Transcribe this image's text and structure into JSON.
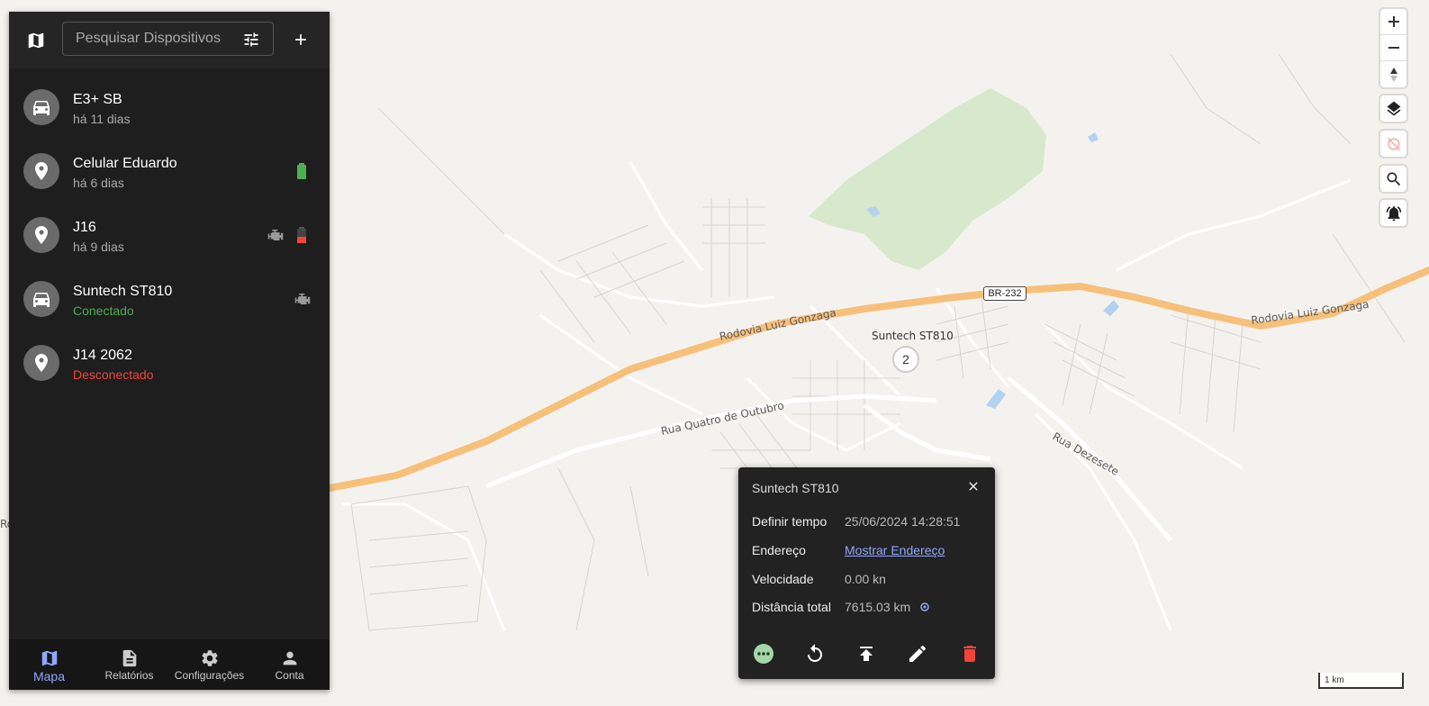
{
  "search": {
    "placeholder": "Pesquisar Dispositivos"
  },
  "devices": [
    {
      "name": "E3+ SB",
      "status": "há 11 dias",
      "icon": "car-icon"
    },
    {
      "name": "Celular Eduardo",
      "status": "há 6 dias",
      "icon": "location-pin-icon"
    },
    {
      "name": "J16",
      "status": "há 9 dias",
      "icon": "location-pin-icon"
    },
    {
      "name": "Suntech ST810",
      "status": "Conectado",
      "icon": "car-icon"
    },
    {
      "name": "J14 2062",
      "status": "Desconectado",
      "icon": "location-pin-icon"
    }
  ],
  "nav": [
    {
      "label": "Mapa",
      "icon": "map-icon"
    },
    {
      "label": "Relatórios",
      "icon": "report-icon"
    },
    {
      "label": "Configurações",
      "icon": "gear-icon"
    },
    {
      "label": "Conta",
      "icon": "person-icon"
    }
  ],
  "map": {
    "roads": [
      "Rodovia Luiz Gonzaga",
      "Rodovia Luiz Gonzaga",
      "Rua Quatro de Outubro",
      "Rua Dezesete"
    ],
    "shield": "BR-232",
    "marker_label": "Suntech ST810",
    "cluster_count": "2",
    "scale": "1 km",
    "edge_label": "Ro"
  },
  "popup": {
    "title": "Suntech ST810",
    "rows": [
      {
        "label": "Definir tempo",
        "value": "25/06/2024 14:28:51"
      },
      {
        "label": "Endereço",
        "value": "Mostrar Endereço"
      },
      {
        "label": "Velocidade",
        "value": "0.00 kn"
      },
      {
        "label": "Distância total",
        "value": "7615.03 km"
      }
    ]
  },
  "colors": {
    "accent": "#8fa8ff",
    "online": "#4caf50",
    "offline": "#f44336",
    "road_major": "#f7c07a",
    "park": "#d8e8cc"
  }
}
